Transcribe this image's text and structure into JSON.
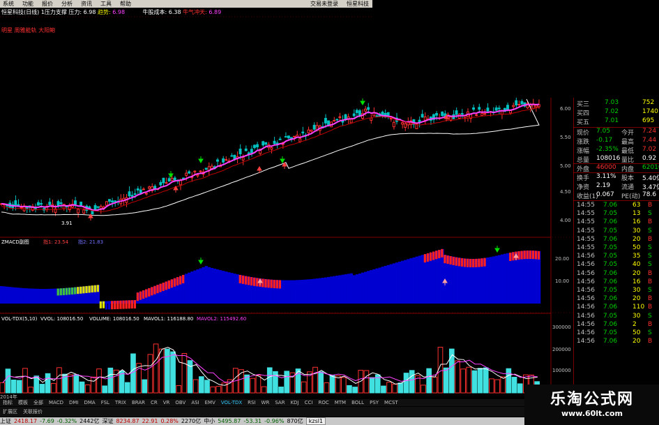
{
  "menu": {
    "items": [
      "系统",
      "功能",
      "报价",
      "分析",
      "资讯",
      "工具",
      "帮助"
    ],
    "right_items": [
      "交易未登录",
      "恒星科技"
    ]
  },
  "chart_header": {
    "name": "恒星科技(日线)",
    "label1": "1压力支撑 压力:",
    "val1": "6.98",
    "label2": "趋势:",
    "val2": "6.98",
    "label3": "牛股成本:",
    "val3": "6.38",
    "label4": "牛气冲天:",
    "val4": "6.89"
  },
  "indicator_line": "明星 周雅能轨 大阳鲍",
  "price_axis": [
    "6.00",
    "5.50",
    "5.00",
    "4.50",
    "4.00"
  ],
  "low_marker": "3.91",
  "macd_header": {
    "title": "ZMACD副图",
    "m1": "指1: 23.54",
    "m2": "指2: 21.83"
  },
  "macd_axis": [
    "20.00",
    "10.00"
  ],
  "vol_header": {
    "a": "VOL-TDX(5,10)",
    "b": "VVOL: 108016.50",
    "c": "VOLUME: 108016.50",
    "d": "MAVOL1: 116188.80",
    "e": "MAVOL2: 115492.60"
  },
  "vol_axis": [
    "300000",
    "200000",
    "100000"
  ],
  "date_label": "2014年",
  "tabs": [
    "指标",
    "模板",
    "全部",
    "MACD",
    "DMI",
    "DMA",
    "FSL",
    "TRIX",
    "BRAR",
    "CR",
    "VR",
    "OBV",
    "ASI",
    "EMV",
    "VOL-TDX",
    "RSI",
    "WR",
    "SAR",
    "KDJ",
    "CCI",
    "ROC",
    "MTM",
    "BOLL",
    "PSY",
    "MCST"
  ],
  "active_tab": "VOL-TDX",
  "sub_tabs": [
    "扩展区",
    "关联报价"
  ],
  "quote": {
    "asks": [
      {
        "label": "买三",
        "price": "7.03",
        "vol": "752"
      },
      {
        "label": "买四",
        "price": "7.02",
        "vol": "1740"
      },
      {
        "label": "买五",
        "price": "7.01",
        "vol": "695"
      }
    ],
    "stats": [
      {
        "l1": "现价",
        "v1": "7.05",
        "l2": "今开",
        "v2": "7.24"
      },
      {
        "l1": "涨跌",
        "v1": "-0.17",
        "l2": "最高",
        "v2": "7.44"
      },
      {
        "l1": "涨幅",
        "v1": "-2.35%",
        "l2": "最低",
        "v2": "7.02"
      },
      {
        "l1": "总量",
        "v1": "108016",
        "l2": "量比",
        "v2": "0.92"
      },
      {
        "l1": "外盘",
        "v1": "46000",
        "l2": "内盘",
        "v2": "62016"
      },
      {
        "l1": "换手",
        "v1": "3.11%",
        "l2": "股本",
        "v2": "5.40亿"
      },
      {
        "l1": "净资",
        "v1": "2.19",
        "l2": "流通",
        "v2": "3.47亿"
      },
      {
        "l1": "收益(1)",
        "v1": "0.067",
        "l2": "PE(动)",
        "v2": "78.6"
      }
    ],
    "ticks": [
      {
        "t": "14:55",
        "p": "7.06",
        "v": "63",
        "s": "B"
      },
      {
        "t": "14:55",
        "p": "7.05",
        "v": "13",
        "s": "S"
      },
      {
        "t": "14:55",
        "p": "7.06",
        "v": "16",
        "s": "B"
      },
      {
        "t": "14:55",
        "p": "7.05",
        "v": "30",
        "s": "S"
      },
      {
        "t": "14:55",
        "p": "7.06",
        "v": "20",
        "s": "B"
      },
      {
        "t": "14:55",
        "p": "7.05",
        "v": "50",
        "s": "S"
      },
      {
        "t": "14:56",
        "p": "7.05",
        "v": "35",
        "s": "S"
      },
      {
        "t": "14:56",
        "p": "7.05",
        "v": "40",
        "s": "S"
      },
      {
        "t": "14:56",
        "p": "7.06",
        "v": "20",
        "s": "B"
      },
      {
        "t": "14:56",
        "p": "7.06",
        "v": "16",
        "s": "B"
      },
      {
        "t": "14:56",
        "p": "7.05",
        "v": "30",
        "s": "S"
      },
      {
        "t": "14:56",
        "p": "7.06",
        "v": "20",
        "s": "B"
      },
      {
        "t": "14:56",
        "p": "7.06",
        "v": "110",
        "s": "B"
      },
      {
        "t": "14:56",
        "p": "7.05",
        "v": "30",
        "s": "S"
      },
      {
        "t": "14:56",
        "p": "7.06",
        "v": "2",
        "s": "B"
      },
      {
        "t": "14:56",
        "p": "7.05",
        "v": "50",
        "s": "S"
      },
      {
        "t": "14:56",
        "p": "7.06",
        "v": "20",
        "s": "B"
      }
    ]
  },
  "bottom": {
    "sh_label": "上证",
    "sh_val": "2418.17",
    "sh_chg": "-7.69",
    "sh_pct": "-0.32%",
    "sh_amt": "2442亿",
    "sz_label": "深证",
    "sz_val": "8234.87",
    "sz_chg": "22.91",
    "sz_pct": "0.28%",
    "sz_amt": "2270亿",
    "zx_label": "中小",
    "zx_val": "5495.87",
    "zx_chg": "-53.31",
    "zx_pct": "-0.96%",
    "zx_amt": "870亿",
    "extra": "kzsl1"
  },
  "watermark": {
    "title": "乐淘公式网",
    "url": "www.60lt.com"
  },
  "colors": {
    "up": "#ff3030",
    "down": "#00c0c0",
    "macd_area": "#0000d0",
    "ma_white": "#ffffff",
    "ma_magenta": "#ff40ff"
  }
}
